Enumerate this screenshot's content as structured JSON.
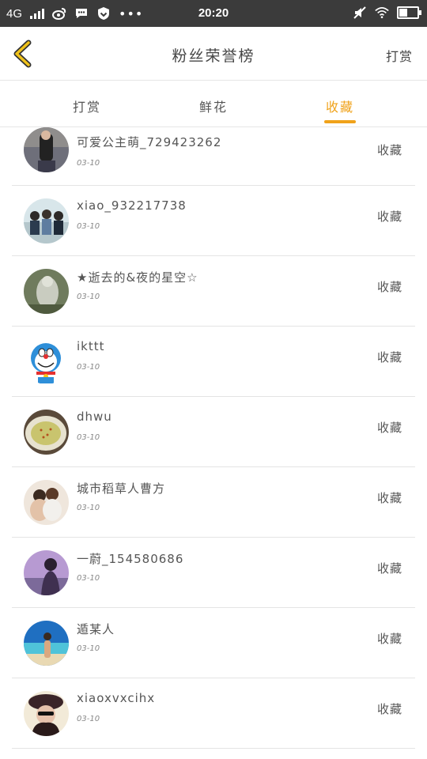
{
  "status_bar": {
    "network": "4G",
    "time": "20:20"
  },
  "header": {
    "title": "粉丝荣誉榜",
    "right_action": "打赏"
  },
  "tabs": [
    {
      "label": "打赏",
      "active": false
    },
    {
      "label": "鲜花",
      "active": false
    },
    {
      "label": "收藏",
      "active": true
    }
  ],
  "colors": {
    "accent": "#f0a21a",
    "status_bar": "#3b3b3b"
  },
  "users": [
    {
      "name": "可爱公主萌_729423262",
      "date": "03-10",
      "action": "收藏",
      "avatar": "street-photo"
    },
    {
      "name": "xiao_932217738",
      "date": "03-10",
      "action": "收藏",
      "avatar": "group-photo"
    },
    {
      "name": "★逝去的&夜的星空☆",
      "date": "03-10",
      "action": "收藏",
      "avatar": "ghostly-figure"
    },
    {
      "name": "ikttt",
      "date": "03-10",
      "action": "收藏",
      "avatar": "doraemon"
    },
    {
      "name": "dhwu",
      "date": "03-10",
      "action": "收藏",
      "avatar": "food-plate"
    },
    {
      "name": "城市稻草人曹方",
      "date": "03-10",
      "action": "收藏",
      "avatar": "couple-photo"
    },
    {
      "name": "一蔚_154580686",
      "date": "03-10",
      "action": "收藏",
      "avatar": "purple-portrait"
    },
    {
      "name": "遁某人",
      "date": "03-10",
      "action": "收藏",
      "avatar": "beach-photo"
    },
    {
      "name": "xiaoxvxcihx",
      "date": "03-10",
      "action": "收藏",
      "avatar": "hat-portrait"
    }
  ]
}
